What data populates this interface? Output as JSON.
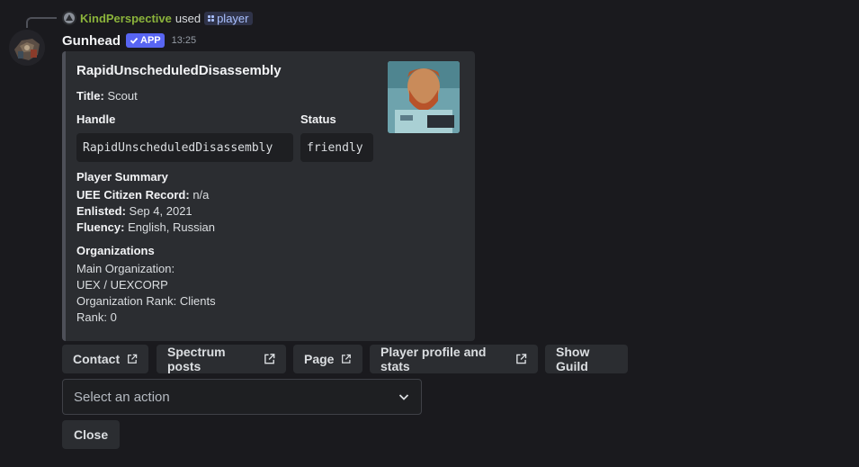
{
  "reply": {
    "user": "KindPerspective",
    "used_text": "used",
    "command": "player"
  },
  "message": {
    "bot_name": "Gunhead",
    "badge": "APP",
    "time": "13:25"
  },
  "embed": {
    "title": "RapidUnscheduledDisassembly",
    "title_field": {
      "label": "Title:",
      "value": "Scout"
    },
    "handle": {
      "label": "Handle",
      "value": "RapidUnscheduledDisassembly"
    },
    "status": {
      "label": "Status",
      "value": "friendly"
    },
    "summary": {
      "heading": "Player Summary",
      "citizen_label": "UEE Citizen Record:",
      "citizen_value": "n/a",
      "enlisted_label": "Enlisted:",
      "enlisted_value": "Sep 4, 2021",
      "fluency_label": "Fluency:",
      "fluency_value": "English, Russian"
    },
    "organizations": {
      "heading": "Organizations",
      "lines": [
        "Main Organization:",
        "UEX / UEXCORP",
        "Organization Rank: Clients",
        "Rank: 0"
      ]
    }
  },
  "buttons": {
    "contact": "Contact",
    "spectrum": "Spectrum posts",
    "page": "Page",
    "profile": "Player profile and stats",
    "guild": "Show Guild"
  },
  "select": {
    "placeholder": "Select an action"
  },
  "close_label": "Close",
  "colors": {
    "background": "#1a1a1e",
    "embed_bg": "#2b2d31",
    "username_green": "#8bb33b",
    "app_badge": "#5865f2"
  }
}
